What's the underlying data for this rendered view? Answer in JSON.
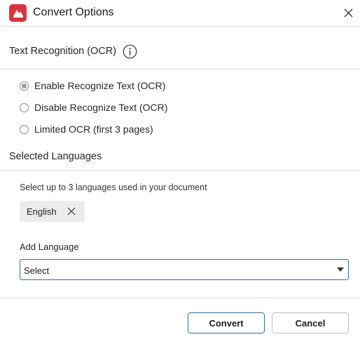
{
  "window": {
    "title": "Convert Options",
    "app_icon": "app-logo-icon",
    "close_icon": "close-icon"
  },
  "ocr": {
    "section_title": "Text Recognition (OCR)",
    "info_icon": "info-icon",
    "options": [
      {
        "label": "Enable Recognize Text (OCR)",
        "selected": true
      },
      {
        "label": "Disable Recognize Text (OCR)",
        "selected": false
      },
      {
        "label": "Limited OCR (first 3 pages)",
        "selected": false
      }
    ]
  },
  "languages": {
    "section_title": "Selected Languages",
    "hint": "Select up to 3 languages used in your document",
    "selected": [
      {
        "label": "English",
        "remove_icon": "close-icon"
      }
    ],
    "add_label": "Add Language",
    "dropdown_value": "Select"
  },
  "footer": {
    "convert_label": "Convert",
    "cancel_label": "Cancel"
  },
  "colors": {
    "accent": "#2f6f9f",
    "brand": "#d9343c"
  }
}
